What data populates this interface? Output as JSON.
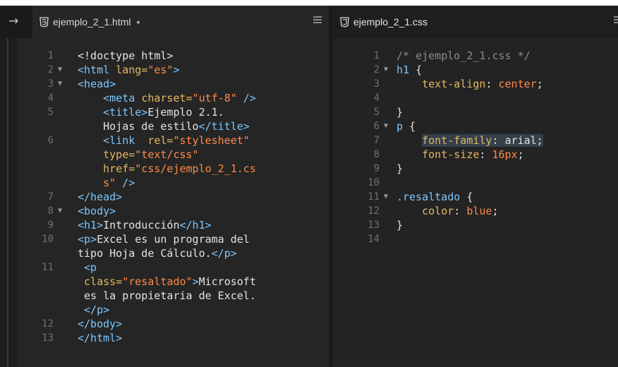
{
  "tabs": [
    {
      "label": "ejemplo_2_1.html",
      "modified": "•"
    },
    {
      "label": "ejemplo_2_1.css"
    }
  ],
  "html_lines": [
    {
      "n": "1",
      "fold": false,
      "parts": [
        [
          "t",
          "<!doctype html>"
        ]
      ]
    },
    {
      "n": "2",
      "fold": true,
      "parts": [
        [
          "g",
          "<html "
        ],
        [
          "a",
          "lang="
        ],
        [
          "s",
          "\"es\""
        ],
        [
          "g",
          ">"
        ]
      ]
    },
    {
      "n": "3",
      "fold": true,
      "parts": [
        [
          "g",
          "<head>"
        ]
      ]
    },
    {
      "n": "4",
      "fold": false,
      "parts": [
        [
          "t",
          "    "
        ],
        [
          "g",
          "<meta "
        ],
        [
          "a",
          "charset="
        ],
        [
          "s",
          "\"utf-8\""
        ],
        [
          "g",
          " />"
        ]
      ]
    },
    {
      "n": "5",
      "fold": false,
      "parts": [
        [
          "t",
          "    "
        ],
        [
          "g",
          "<title>"
        ],
        [
          "t",
          "Ejemplo 2.1."
        ]
      ]
    },
    {
      "n": "",
      "fold": false,
      "parts": [
        [
          "t",
          "    Hojas de estilo"
        ],
        [
          "g",
          "</title>"
        ]
      ]
    },
    {
      "n": "6",
      "fold": false,
      "parts": [
        [
          "t",
          "    "
        ],
        [
          "g",
          "<link  "
        ],
        [
          "a",
          "rel="
        ],
        [
          "s",
          "\"stylesheet\""
        ]
      ]
    },
    {
      "n": "",
      "fold": false,
      "parts": [
        [
          "t",
          "    "
        ],
        [
          "a",
          "type="
        ],
        [
          "s",
          "\"text/css\""
        ]
      ]
    },
    {
      "n": "",
      "fold": false,
      "parts": [
        [
          "t",
          "    "
        ],
        [
          "a",
          "href="
        ],
        [
          "s",
          "\"css/ejemplo_2_1.cs"
        ]
      ]
    },
    {
      "n": "",
      "fold": false,
      "parts": [
        [
          "t",
          "    "
        ],
        [
          "s",
          "s\""
        ],
        [
          "g",
          " />"
        ]
      ]
    },
    {
      "n": "7",
      "fold": false,
      "parts": [
        [
          "g",
          "</head>"
        ]
      ]
    },
    {
      "n": "8",
      "fold": true,
      "parts": [
        [
          "g",
          "<body>"
        ]
      ]
    },
    {
      "n": "9",
      "fold": false,
      "parts": [
        [
          "g",
          "<h1>"
        ],
        [
          "t",
          "Introducción"
        ],
        [
          "g",
          "</h1>"
        ]
      ]
    },
    {
      "n": "10",
      "fold": false,
      "parts": [
        [
          "g",
          "<p>"
        ],
        [
          "t",
          "Excel es un programa del"
        ]
      ]
    },
    {
      "n": "",
      "fold": false,
      "parts": [
        [
          "t",
          "tipo Hoja de Cálculo."
        ],
        [
          "g",
          "</p>"
        ]
      ]
    },
    {
      "n": "11",
      "fold": false,
      "parts": [
        [
          "t",
          " "
        ],
        [
          "g",
          "<p"
        ]
      ]
    },
    {
      "n": "",
      "fold": false,
      "parts": [
        [
          "t",
          " "
        ],
        [
          "a",
          "class="
        ],
        [
          "s",
          "\"resaltado\""
        ],
        [
          "g",
          ">"
        ],
        [
          "t",
          "Microsoft"
        ]
      ]
    },
    {
      "n": "",
      "fold": false,
      "parts": [
        [
          "t",
          " es la propietaria de Excel."
        ]
      ]
    },
    {
      "n": "",
      "fold": false,
      "parts": [
        [
          "t",
          " "
        ],
        [
          "g",
          "</p>"
        ]
      ]
    },
    {
      "n": "12",
      "fold": false,
      "parts": [
        [
          "g",
          "</body>"
        ]
      ]
    },
    {
      "n": "13",
      "fold": false,
      "parts": [
        [
          "g",
          "</html>"
        ]
      ]
    }
  ],
  "css_lines": [
    {
      "n": "1",
      "fold": false,
      "parts": [
        [
          "c",
          "/* ejemplo_2_1.css */"
        ]
      ]
    },
    {
      "n": "2",
      "fold": true,
      "parts": [
        [
          "k",
          "h1"
        ],
        [
          "t",
          " {"
        ]
      ]
    },
    {
      "n": "3",
      "fold": false,
      "parts": [
        [
          "t",
          "    "
        ],
        [
          "p",
          "text-align"
        ],
        [
          "t",
          ": "
        ],
        [
          "v",
          "center"
        ],
        [
          "t",
          ";"
        ]
      ]
    },
    {
      "n": "4",
      "fold": false,
      "parts": []
    },
    {
      "n": "5",
      "fold": false,
      "parts": [
        [
          "t",
          "}"
        ]
      ]
    },
    {
      "n": "6",
      "fold": true,
      "parts": [
        [
          "k",
          "p"
        ],
        [
          "t",
          " {"
        ]
      ]
    },
    {
      "n": "7",
      "fold": false,
      "hl": true,
      "parts": [
        [
          "t",
          "    "
        ],
        [
          "p",
          "font-family"
        ],
        [
          "t",
          ": arial;"
        ]
      ]
    },
    {
      "n": "8",
      "fold": false,
      "parts": [
        [
          "t",
          "    "
        ],
        [
          "p",
          "font-size"
        ],
        [
          "t",
          ": "
        ],
        [
          "v",
          "16px"
        ],
        [
          "t",
          ";"
        ]
      ]
    },
    {
      "n": "9",
      "fold": false,
      "parts": [
        [
          "t",
          "}"
        ]
      ]
    },
    {
      "n": "10",
      "fold": false,
      "parts": []
    },
    {
      "n": "11",
      "fold": true,
      "parts": [
        [
          "k",
          ".resaltado"
        ],
        [
          "t",
          " {"
        ]
      ]
    },
    {
      "n": "12",
      "fold": false,
      "parts": [
        [
          "t",
          "    "
        ],
        [
          "p",
          "color"
        ],
        [
          "t",
          ": "
        ],
        [
          "v",
          "blue"
        ],
        [
          "t",
          ";"
        ]
      ]
    },
    {
      "n": "13",
      "fold": false,
      "parts": [
        [
          "t",
          "}"
        ]
      ]
    },
    {
      "n": "14",
      "fold": false,
      "parts": []
    }
  ]
}
